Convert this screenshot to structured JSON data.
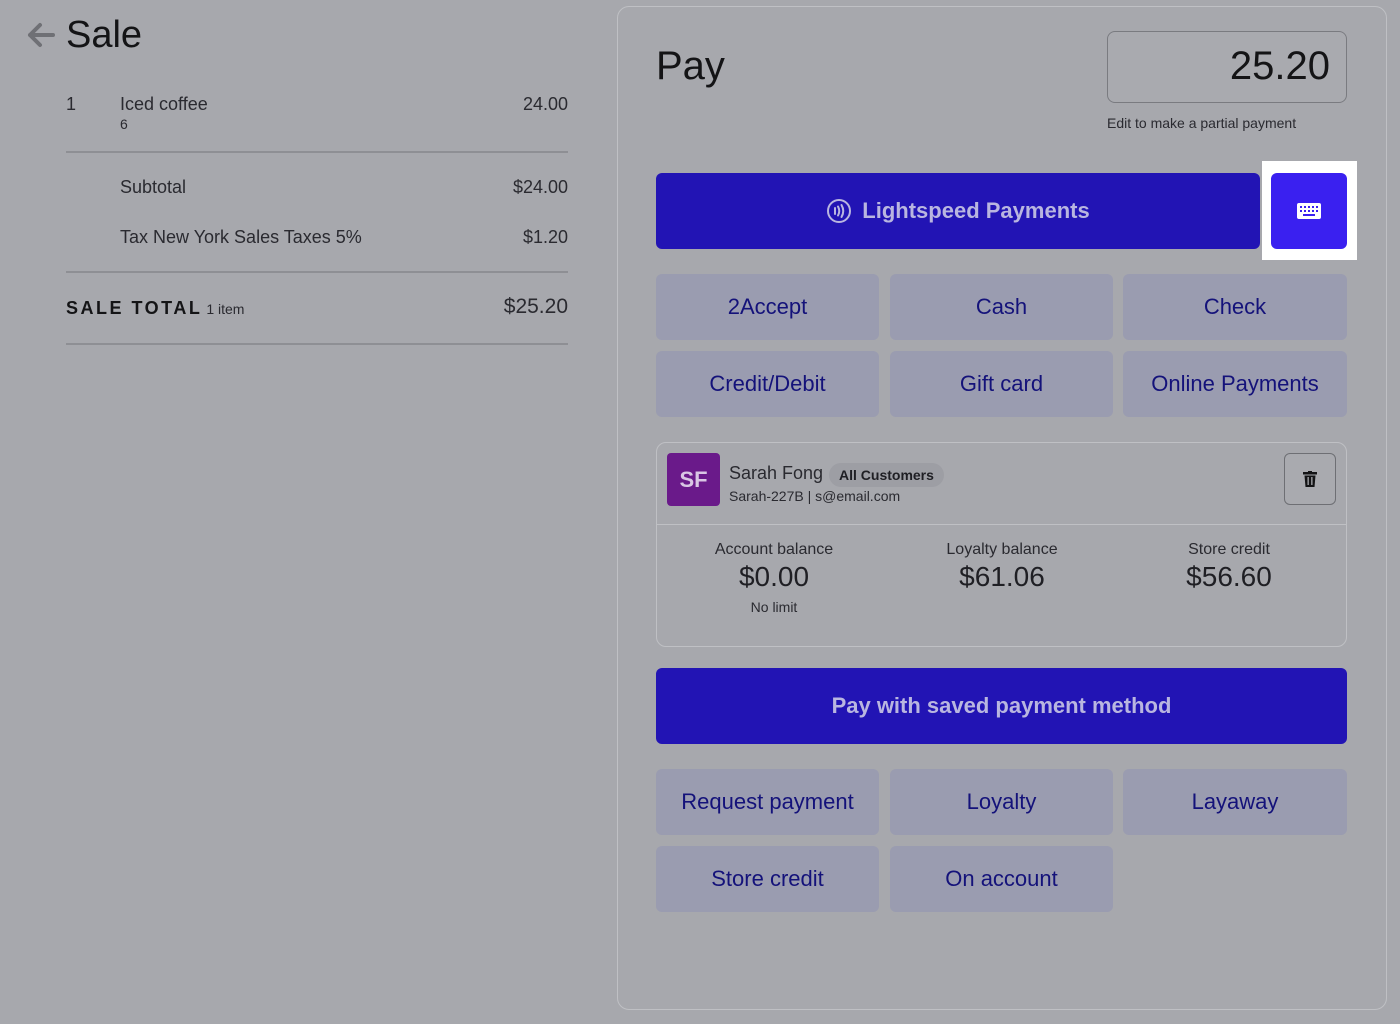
{
  "sale": {
    "title": "Sale",
    "line_items": [
      {
        "qty": "1",
        "name": "Iced coffee",
        "note": "6",
        "price": "24.00"
      }
    ],
    "subtotal_label": "Subtotal",
    "subtotal_value": "$24.00",
    "tax_label": "Tax New York Sales Taxes 5%",
    "tax_value": "$1.20",
    "total_label": "SALE TOTAL",
    "total_count": "1 item",
    "total_value": "$25.20"
  },
  "pay": {
    "title": "Pay",
    "amount": "25.20",
    "amount_hint": "Edit to make a partial payment",
    "lightspeed_label": "Lightspeed Payments",
    "methods": [
      "2Accept",
      "Cash",
      "Check",
      "Credit/Debit",
      "Gift card",
      "Online Payments"
    ],
    "saved_method_label": "Pay with saved payment method",
    "more_methods": [
      "Request payment",
      "Loyalty",
      "Layaway",
      "Store credit",
      "On account"
    ]
  },
  "customer": {
    "initials": "SF",
    "name": "Sarah Fong",
    "group": "All Customers",
    "details": "Sarah-227B | s@email.com",
    "account_balance_label": "Account balance",
    "account_balance": "$0.00",
    "account_balance_note": "No limit",
    "loyalty_balance_label": "Loyalty balance",
    "loyalty_balance": "$61.06",
    "store_credit_label": "Store credit",
    "store_credit": "$56.60"
  },
  "icons": {
    "back": "arrow-left-icon",
    "lightspeed": "contactless-icon",
    "keyboard": "keyboard-icon",
    "trash": "trash-icon"
  },
  "colors": {
    "primary": "#2214b4",
    "keyboard_button": "#3a20f0",
    "tile": "#9a9cb0",
    "tile_text": "#14127a",
    "avatar": "#6a1a8a"
  }
}
